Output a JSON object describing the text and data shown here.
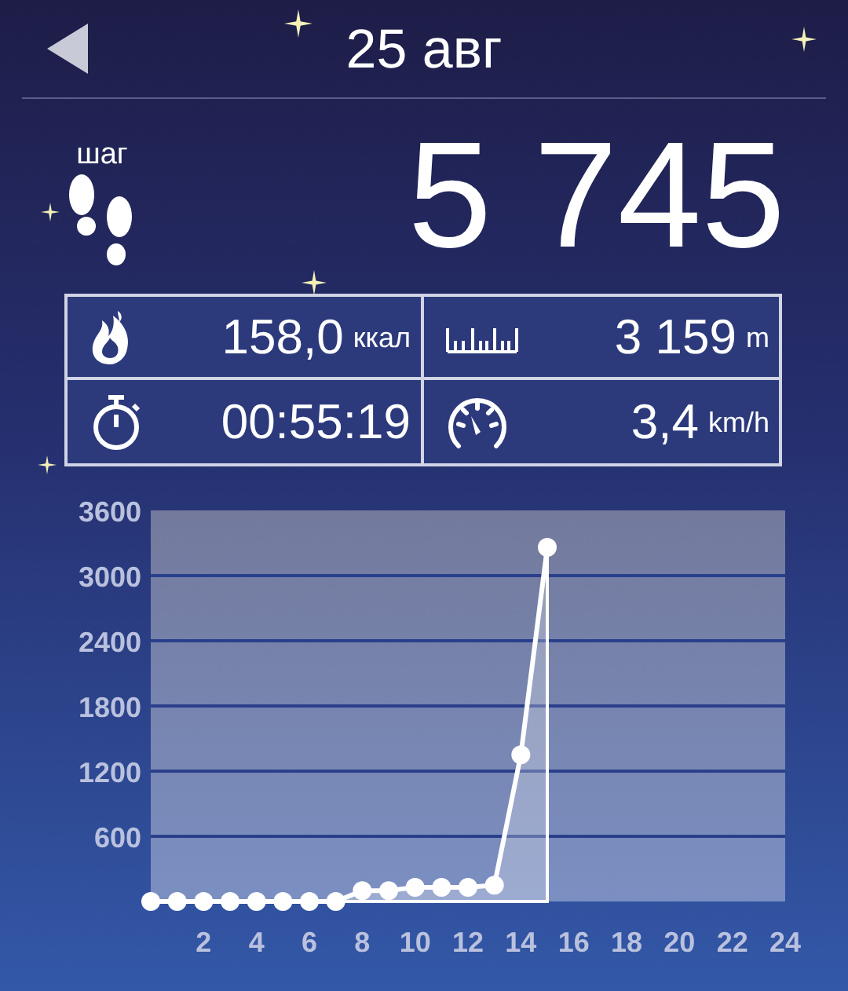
{
  "header": {
    "title": "25 авг"
  },
  "steps": {
    "label": "шаг",
    "value": "5 745"
  },
  "stats": [
    {
      "kind": "calories",
      "value": "158,0",
      "unit": "ккал"
    },
    {
      "kind": "distance",
      "value": "3 159",
      "unit": "m"
    },
    {
      "kind": "duration",
      "value": "00:55:19"
    },
    {
      "kind": "speed",
      "value": "3,4",
      "unit": "km/h"
    }
  ],
  "chart": {
    "chart_data": {
      "type": "area",
      "x": [
        0,
        1,
        2,
        3,
        4,
        5,
        6,
        7,
        8,
        9,
        10,
        11,
        12,
        13,
        14,
        15
      ],
      "grid": true,
      "series": [
        {
          "color": "#ffffff",
          "values": [
            0,
            0,
            0,
            0,
            0,
            0,
            0,
            0,
            100,
            100,
            130,
            130,
            130,
            150,
            1350,
            3260
          ]
        }
      ],
      "xlim": [
        0,
        24
      ],
      "ylim": [
        0,
        3600
      ],
      "xticks": [
        2,
        4,
        6,
        8,
        10,
        12,
        14,
        16,
        18,
        20,
        22,
        24
      ],
      "yticks": [
        {
          "value": 600,
          "label": "600"
        },
        {
          "value": 1200,
          "label": "1200"
        },
        {
          "value": 1800,
          "label": "1800"
        },
        {
          "value": 2400,
          "label": "2400"
        },
        {
          "value": 3000,
          "label": "3000"
        },
        {
          "value": 3600,
          "label": "3600"
        }
      ]
    }
  }
}
